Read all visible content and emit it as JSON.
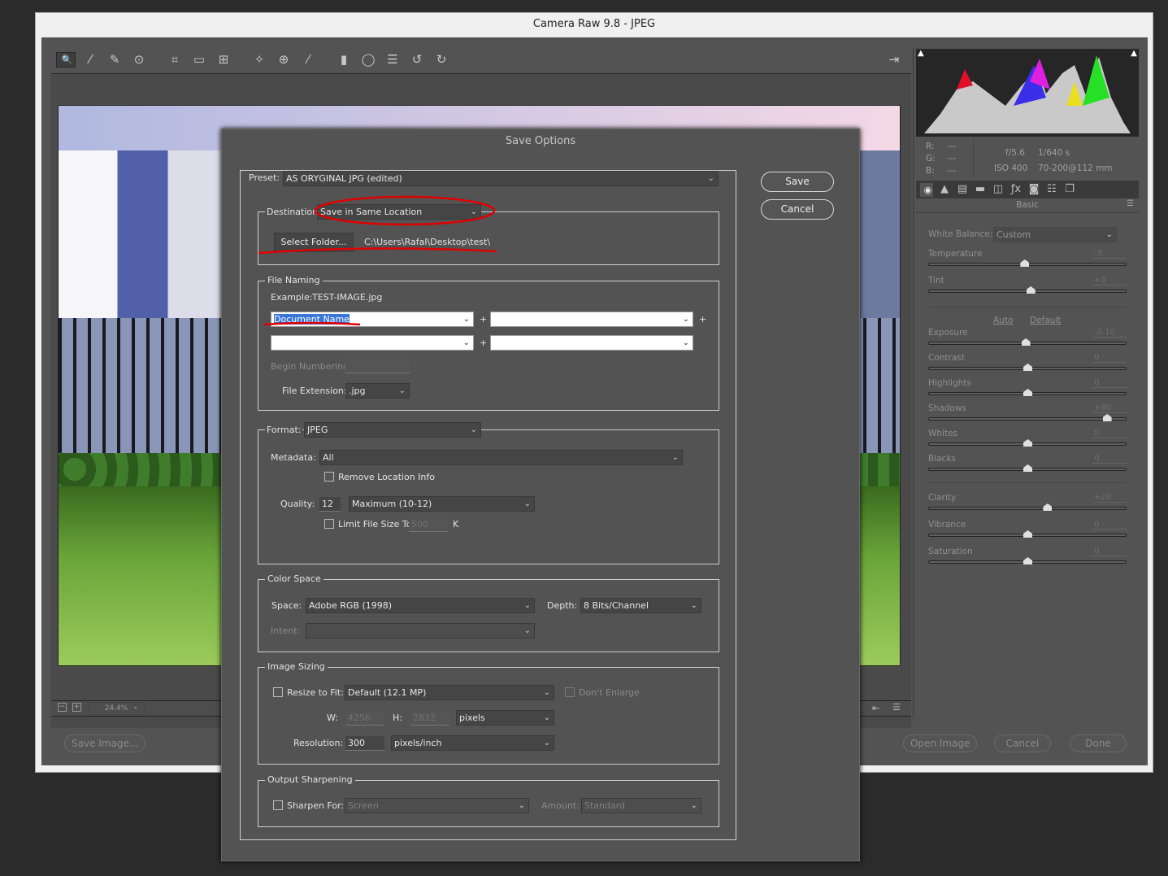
{
  "window": {
    "title": "Camera Raw 9.8  -  JPEG"
  },
  "toolbar": {
    "tools": [
      {
        "icon": "zoom-icon",
        "glyph": "🔍",
        "selected": true
      },
      {
        "icon": "hand-icon",
        "glyph": "✋"
      },
      {
        "icon": "white-balance-icon",
        "glyph": "⁄"
      },
      {
        "icon": "color-sampler-icon",
        "glyph": "✎"
      },
      {
        "icon": "targeted-adjustment-icon",
        "glyph": "⊙"
      },
      {
        "icon": "crop-icon",
        "glyph": "⌗"
      },
      {
        "icon": "straighten-icon",
        "glyph": "▭"
      },
      {
        "icon": "transform-icon",
        "glyph": "⊞"
      },
      {
        "icon": "spot-removal-icon",
        "glyph": "✧"
      },
      {
        "icon": "red-eye-icon",
        "glyph": "⊕"
      },
      {
        "icon": "adjustment-brush-icon",
        "glyph": "⁄"
      },
      {
        "icon": "graduated-filter-icon",
        "glyph": "▮"
      },
      {
        "icon": "radial-filter-icon",
        "glyph": "◯"
      },
      {
        "icon": "preferences-icon",
        "glyph": "☰"
      },
      {
        "icon": "rotate-left-icon",
        "glyph": "↺"
      },
      {
        "icon": "rotate-right-icon",
        "glyph": "↻"
      }
    ],
    "export_icon": "open-export-icon"
  },
  "preview": {
    "zoom": "24.4%"
  },
  "bottom": {
    "save_image": "Save Image...",
    "open_image": "Open Image",
    "cancel": "Cancel",
    "done": "Done"
  },
  "right_panel": {
    "rgb": {
      "r_label": "R:",
      "g_label": "G:",
      "b_label": "B:",
      "r": "---",
      "g": "---",
      "b": "---"
    },
    "exif": {
      "aperture": "f/5.6",
      "shutter": "1/640 s",
      "iso": "ISO 400",
      "lens": "70-200@112 mm"
    },
    "tabs": [
      "basic-icon",
      "tone-curve-icon",
      "detail-icon",
      "hsl-icon",
      "split-toning-icon",
      "lens-corrections-icon",
      "effects-icon",
      "camera-calibration-icon",
      "presets-icon",
      "snapshots-icon"
    ],
    "section_title": "Basic",
    "white_balance": {
      "label": "White Balance:",
      "value": "Custom"
    },
    "auto": "Auto",
    "default": "Default",
    "sliders": [
      {
        "label": "Temperature",
        "value": "-3",
        "num": -3,
        "min": -100,
        "max": 100
      },
      {
        "label": "Tint",
        "value": "+3",
        "num": 3,
        "min": -100,
        "max": 100
      },
      {
        "label": "Exposure",
        "value": "-0.10",
        "num": -0.1,
        "min": -5,
        "max": 5
      },
      {
        "label": "Contrast",
        "value": "0",
        "num": 0,
        "min": -100,
        "max": 100
      },
      {
        "label": "Highlights",
        "value": "0",
        "num": 0,
        "min": -100,
        "max": 100
      },
      {
        "label": "Shadows",
        "value": "+80",
        "num": 80,
        "min": -100,
        "max": 100
      },
      {
        "label": "Whites",
        "value": "0",
        "num": 0,
        "min": -100,
        "max": 100
      },
      {
        "label": "Blacks",
        "value": "0",
        "num": 0,
        "min": -100,
        "max": 100
      },
      {
        "label": "Clarity",
        "value": "+20",
        "num": 20,
        "min": -100,
        "max": 100
      },
      {
        "label": "Vibrance",
        "value": "0",
        "num": 0,
        "min": -100,
        "max": 100
      },
      {
        "label": "Saturation",
        "value": "0",
        "num": 0,
        "min": -100,
        "max": 100
      }
    ]
  },
  "dialog": {
    "title": "Save Options",
    "save": "Save",
    "cancel": "Cancel",
    "preset": {
      "label": "Preset:",
      "value": "AS ORYGINAL JPG (edited)"
    },
    "destination": {
      "label": "Destination:",
      "value": "Save in Same Location",
      "select_folder": "Select Folder...",
      "path": "C:\\Users\\Rafal\\Desktop\\test\\"
    },
    "file_naming": {
      "legend": "File Naming",
      "example_label": "Example:",
      "example": "TEST-IMAGE.jpg",
      "field1": "Document Name",
      "field2": "",
      "field3": "",
      "field4": "",
      "plus": "+",
      "begin_numbering": "Begin Numbering:",
      "ext_label": "File Extension:",
      "ext": ".jpg"
    },
    "format": {
      "label": "Format:",
      "value": "JPEG",
      "metadata_label": "Metadata:",
      "metadata": "All",
      "remove_location": "Remove Location Info",
      "quality_label": "Quality:",
      "quality": "12",
      "quality_preset": "Maximum  (10-12)",
      "limit_size": "Limit File Size To:",
      "limit_value": "500",
      "limit_unit": "K"
    },
    "color_space": {
      "legend": "Color Space",
      "space_label": "Space:",
      "space": "Adobe RGB (1998)",
      "depth_label": "Depth:",
      "depth": "8 Bits/Channel",
      "intent_label": "Intent:",
      "intent": ""
    },
    "image_sizing": {
      "legend": "Image Sizing",
      "resize_label": "Resize to Fit:",
      "resize": "Default  (12.1 MP)",
      "dont_enlarge": "Don't Enlarge",
      "w_label": "W:",
      "w": "4256",
      "h_label": "H:",
      "h": "2832",
      "unit": "pixels",
      "res_label": "Resolution:",
      "res": "300",
      "res_unit": "pixels/inch"
    },
    "sharpening": {
      "legend": "Output Sharpening",
      "sharpen_label": "Sharpen For:",
      "sharpen": "Screen",
      "amount_label": "Amount:",
      "amount": "Standard"
    }
  },
  "colors": {
    "annotation": "#e00000",
    "selection": "#3875d7"
  }
}
